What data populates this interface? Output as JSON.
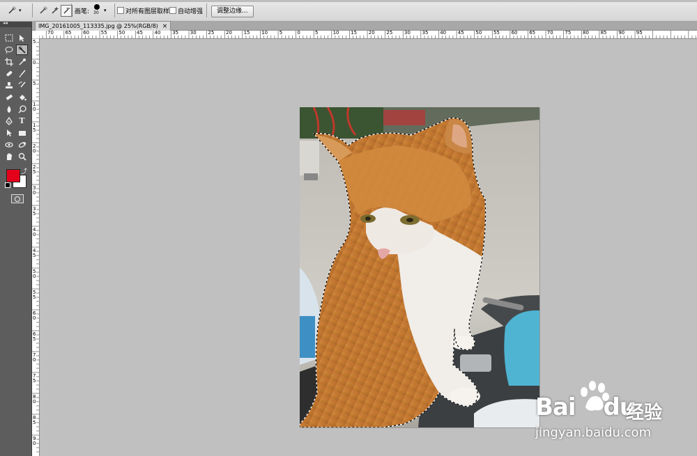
{
  "options_bar": {
    "brush_label": "画笔:",
    "brush_size": "30",
    "sample_all_layers_label": "对所有图层取样",
    "auto_enhance_label": "自动增强",
    "refine_edge_button": "调整边缘..."
  },
  "document": {
    "tab_title": "IMG_20161005_113335.jpg @ 25%(RGB/8)",
    "close_glyph": "×"
  },
  "rulers": {
    "horizontal_labels": [
      "70",
      "65",
      "60",
      "55",
      "50",
      "45",
      "40",
      "35",
      "30",
      "25",
      "20",
      "15",
      "10",
      "5",
      "0",
      "5",
      "10",
      "15",
      "20",
      "25",
      "30",
      "35",
      "40",
      "45",
      "50",
      "55",
      "60",
      "65",
      "70",
      "75",
      "80",
      "85",
      "90",
      "95"
    ],
    "vertical_labels": [
      "5",
      "0",
      "5",
      "1 0",
      "1 5",
      "2 0",
      "2 5",
      "3 0",
      "3 5",
      "4 0",
      "4 5",
      "5 0",
      "5 5",
      "6 0",
      "6 5",
      "7 0",
      "7 5",
      "8 0",
      "8 5",
      "9 0"
    ]
  },
  "colors": {
    "foreground": "#e4001b",
    "background": "#ffffff",
    "workspace": "#c0c0c0",
    "tools_panel": "#5d5d5d"
  },
  "tools": {
    "header_glyph": "◂◂",
    "icons": [
      [
        "marquee-icon",
        "move-icon"
      ],
      [
        "lasso-icon",
        "quick-selection-icon"
      ],
      [
        "crop-icon",
        "eyedropper-icon"
      ],
      [
        "healing-brush-icon",
        "brush-icon"
      ],
      [
        "clone-stamp-icon",
        "history-brush-icon"
      ],
      [
        "eraser-icon",
        "paint-bucket-icon"
      ],
      [
        "blur-icon",
        "dodge-icon"
      ],
      [
        "pen-icon",
        "type-icon"
      ],
      [
        "path-selection-icon",
        "rectangle-shape-icon"
      ],
      [
        "3d-rotate-icon",
        "3d-orbit-icon"
      ],
      [
        "hand-icon",
        "zoom-icon"
      ]
    ],
    "type_glyph": "T"
  },
  "watermark": {
    "brand": "Bai",
    "brand_suffix": "du",
    "chinese": "经验",
    "url": "jingyan.baidu.com"
  }
}
